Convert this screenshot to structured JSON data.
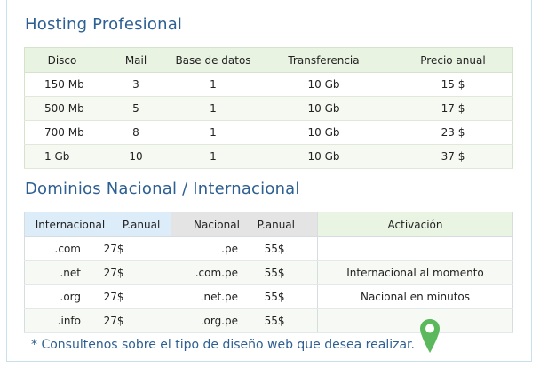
{
  "hosting": {
    "title": "Hosting Profesional",
    "headers": [
      "Disco",
      "Mail",
      "Base de datos",
      "Transferencia",
      "Precio anual"
    ],
    "rows": [
      [
        "150 Mb",
        "3",
        "1",
        "10 Gb",
        "15 $"
      ],
      [
        "500 Mb",
        "5",
        "1",
        "10 Gb",
        "17 $"
      ],
      [
        "700 Mb",
        "8",
        "1",
        "10 Gb",
        "23 $"
      ],
      [
        "1 Gb",
        "10",
        "1",
        "10 Gb",
        "37 $"
      ]
    ]
  },
  "domains": {
    "title": "Dominios Nacional / Internacional",
    "headers": {
      "intl": "Internacional",
      "intl_price": "P.anual",
      "nac": "Nacional",
      "nac_price": "P.anual",
      "act": "Activación"
    },
    "rows": [
      {
        "intl": ".com",
        "intl_price": "27$",
        "nac": ".pe",
        "nac_price": "55$",
        "act": ""
      },
      {
        "intl": ".net",
        "intl_price": "27$",
        "nac": ".com.pe",
        "nac_price": "55$",
        "act": "Internacional al momento"
      },
      {
        "intl": ".org",
        "intl_price": "27$",
        "nac": ".net.pe",
        "nac_price": "55$",
        "act": "Nacional en minutos"
      },
      {
        "intl": ".info",
        "intl_price": "27$",
        "nac": ".org.pe",
        "nac_price": "55$",
        "act": ""
      }
    ]
  },
  "note": "* Consultenos sobre el tipo de diseño web que desea realizar.",
  "pin_icon": "map-pin-icon",
  "colors": {
    "title": "#2d5f92",
    "pin": "#5cb85c",
    "header_green": "#e9f3e2",
    "header_blue": "#dcedf9"
  }
}
